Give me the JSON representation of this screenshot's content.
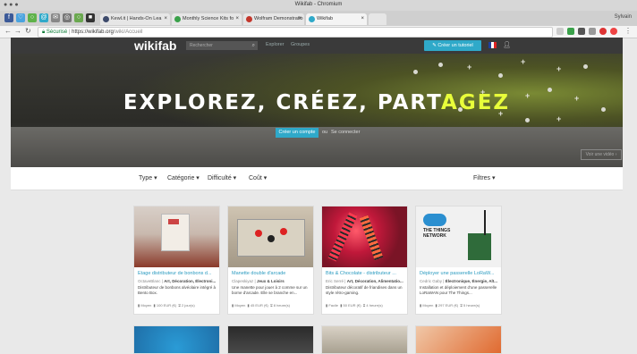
{
  "browser": {
    "window_title": "Wikifab - Chromium",
    "user_label": "Sylvain",
    "tabs": [
      {
        "label": "Kewl.it | Hands-On Lea",
        "color": "#3d4a6b"
      },
      {
        "label": "Monthly Science Kits fo",
        "color": "#3aa14a"
      },
      {
        "label": "Wolfram Demonstratio",
        "color": "#c3362b"
      },
      {
        "label": "Wikifab",
        "color": "#2fa9c9"
      }
    ],
    "url_secure": "Sécurisé",
    "url_domain": "https://wikifab.org",
    "url_path": "/wiki/Accueil"
  },
  "site": {
    "logo": "wikifab",
    "search_placeholder": "Rechercher",
    "nav": [
      "Explorer",
      "Groupes"
    ],
    "create_button": "✎ Créer un tutoriel"
  },
  "hero": {
    "headline_a": "EXPLOREZ, CRÉEZ, PART",
    "headline_b": "AGEZ",
    "cta": "Créer un compte",
    "or": "ou",
    "login": "Se connecter",
    "video": "Voir une vidéo ›"
  },
  "filters": {
    "type": "Type ▾",
    "category": "Catégorie ▾",
    "difficulty": "Difficulté ▾",
    "cost": "Coût ▾",
    "more": "Filtres ▾"
  },
  "cards": [
    {
      "title": "Étage distributeur de bonbons d...",
      "author": "OctaveBlanc",
      "cats": "Art, Décoration, Électroni...",
      "desc": "Distributeur de bonbons alvéolaire intégré à Bento Box.",
      "level": "Moyen",
      "cost": "100 EUR (€)",
      "time": "2 jour(s)"
    },
    {
      "title": "Manette double d'arcade",
      "author": "Clapeskiyaz",
      "cats": "Jeux & Loisirs",
      "desc": "Une manette pour jouer à 2 comme sur un borne d'arcade. Elle se branche en...",
      "level": "Moyen",
      "cost": "45 EUR (€)",
      "time": "8 heure(s)"
    },
    {
      "title": "Bits & Chocolate - distributeur ...",
      "author": "Eric Serré",
      "cats": "Art, Décoration, Alimentatio...",
      "desc": "Distributeur décoratif de friandises dans un style rétro-gaming.",
      "level": "Facile",
      "cost": "50 EUR (€)",
      "time": "4 heure(s)"
    },
    {
      "title": "Déployer une passerelle LoRaW...",
      "author": "Cedric Gaby",
      "cats": "Électronique, Énergie, Alt...",
      "desc": "Installation et déploiement d'une passerelle LoRaWAN pour The Things...",
      "level": "Moyen",
      "cost": "297 EUR (€)",
      "time": "5 heure(s)"
    }
  ],
  "colors": {
    "accent": "#2fa9c9",
    "header": "#3a3a3a",
    "highlight": "#e8ff3a"
  }
}
